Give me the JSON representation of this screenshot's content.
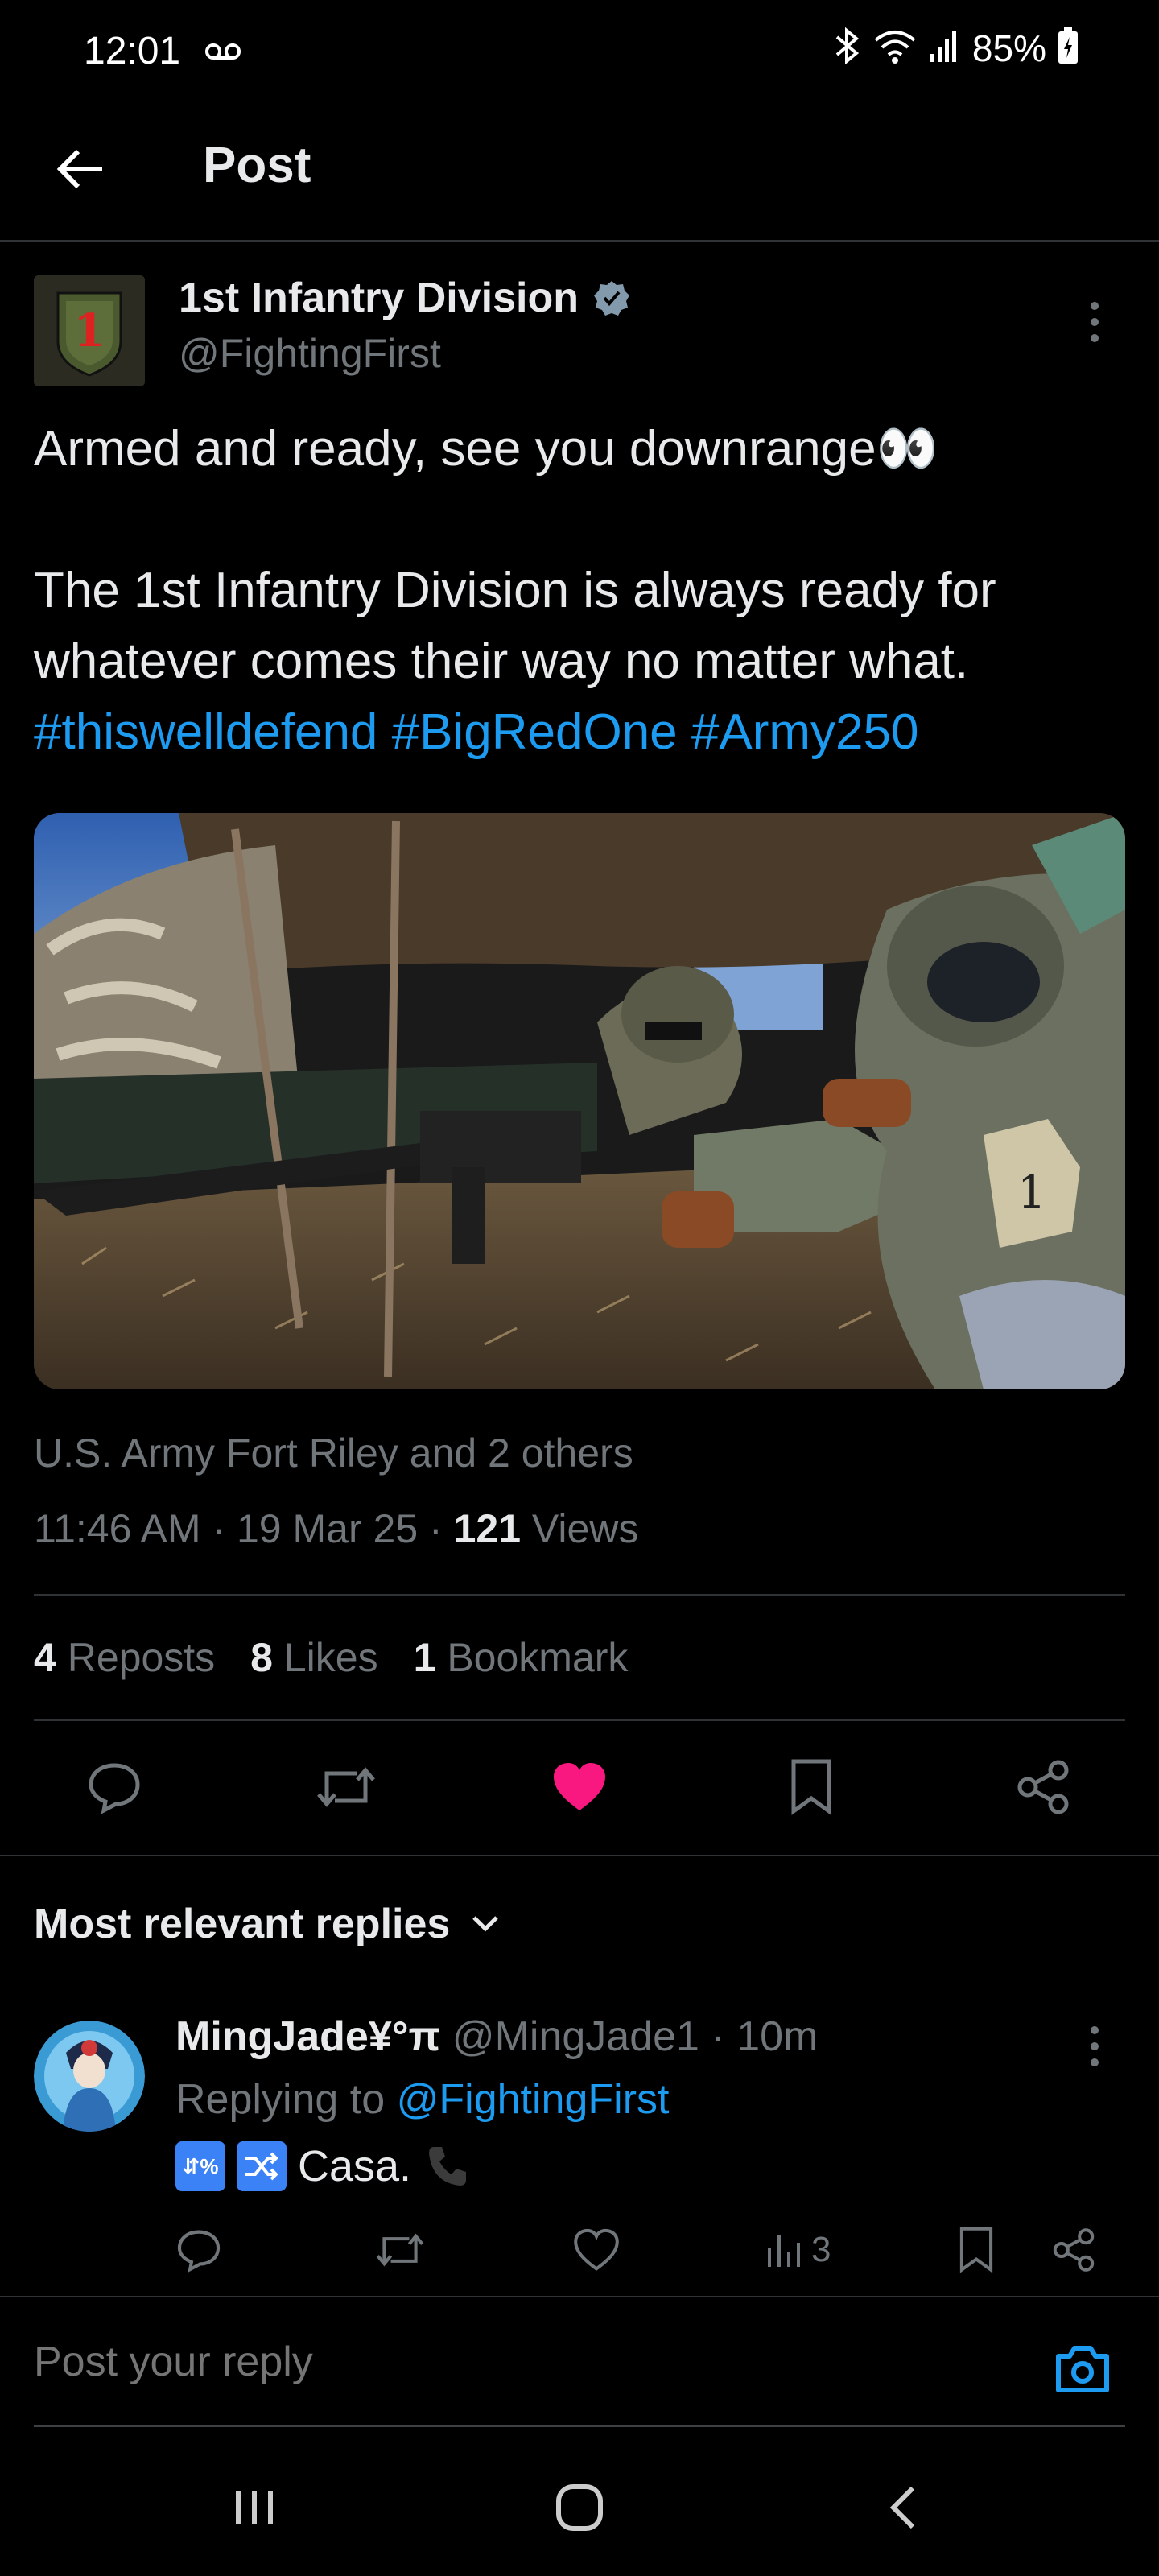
{
  "status_bar": {
    "time": "12:01",
    "battery": "85%"
  },
  "header": {
    "title": "Post"
  },
  "post": {
    "author_name": "1st Infantry Division",
    "author_handle": "@FightingFirst",
    "text_line1": "Armed and ready, see you downrange👀",
    "text_line2": "The 1st Infantry Division is always ready for whatever comes their way no matter what.",
    "hashtags": [
      "#thiswelldefend",
      "#BigRedOne",
      "#Army250"
    ],
    "social_context": "U.S. Army Fort Riley and 2 others",
    "time": "11:46 AM",
    "date": "19 Mar 25",
    "views_count": "121",
    "views_label": "Views",
    "reposts_count": "4",
    "reposts_label": "Reposts",
    "likes_count": "8",
    "likes_label": "Likes",
    "bookmarks_count": "1",
    "bookmarks_label": "Bookmark"
  },
  "replies": {
    "heading": "Most relevant replies",
    "items": [
      {
        "name": "MingJade¥°π",
        "handle": "@MingJade1",
        "time": "10m",
        "replying_label": "Replying to",
        "replying_to": "@FightingFirst",
        "text": "Casa.",
        "emoji1": "⁋&%",
        "views": "3"
      }
    ]
  },
  "compose": {
    "placeholder": "Post your reply"
  },
  "colors": {
    "accent": "#1d9bf0",
    "like": "#f91880",
    "muted": "#71767b",
    "background": "#000000"
  }
}
